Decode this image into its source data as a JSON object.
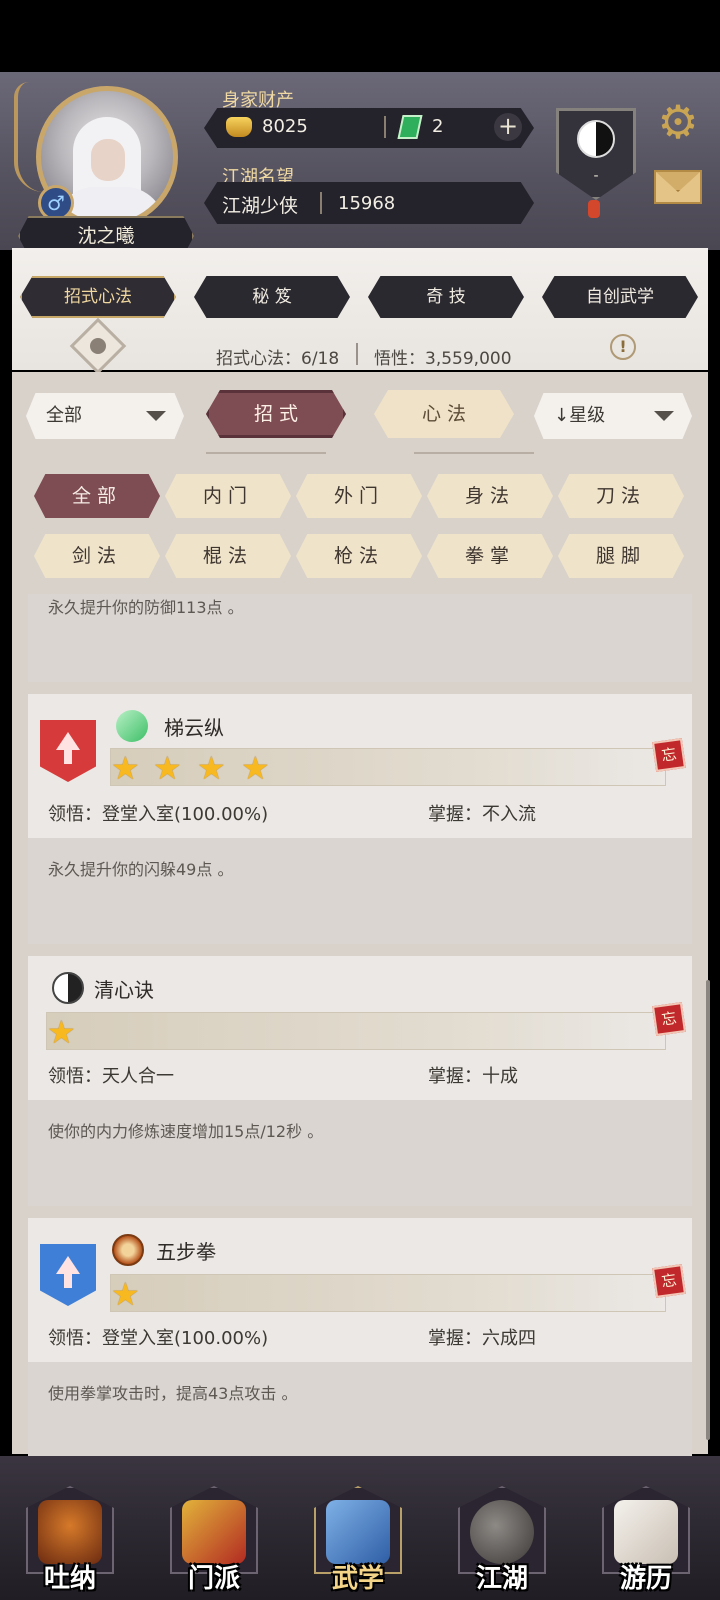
{
  "header": {
    "player_name": "沈之曦",
    "gender_symbol": "♂",
    "wealth_label": "身家财产",
    "gold": "8025",
    "jade": "2",
    "plus": "+",
    "fame_label": "江湖名望",
    "fame_title": "江湖少侠",
    "fame_value": "15968",
    "sect_value": "-"
  },
  "category_tabs": [
    {
      "label": "招式心法",
      "active": true
    },
    {
      "label": "秘 笈",
      "active": false
    },
    {
      "label": "奇 技",
      "active": false
    },
    {
      "label": "自创武学",
      "active": false
    }
  ],
  "stats": {
    "learned": "招式心法：6/18",
    "insight": "悟性：3,559,000",
    "info_mark": "!"
  },
  "filters": {
    "scope_select": "全部",
    "type_buttons": [
      {
        "label": "招 式",
        "active": true
      },
      {
        "label": "心 法",
        "active": false
      }
    ],
    "sort_select": "↓星级"
  },
  "chips": [
    {
      "label": "全部",
      "active": true
    },
    {
      "label": "内门",
      "active": false
    },
    {
      "label": "外门",
      "active": false
    },
    {
      "label": "身法",
      "active": false
    },
    {
      "label": "刀法",
      "active": false
    },
    {
      "label": "剑法",
      "active": false
    },
    {
      "label": "棍法",
      "active": false
    },
    {
      "label": "枪法",
      "active": false
    },
    {
      "label": "拳掌",
      "active": false
    },
    {
      "label": "腿脚",
      "active": false
    }
  ],
  "skills": [
    {
      "name": "",
      "stars": 0,
      "comprehension_label": "",
      "comprehension": "",
      "mastery_label": "",
      "mastery": "",
      "description": "永久提升你的防御113点 。"
    },
    {
      "name": "梯云纵",
      "stars": 4,
      "comprehension_label": "领悟",
      "comprehension": "登堂入室(100.00%)",
      "mastery_label": "掌握",
      "mastery": "不入流",
      "description": "永久提升你的闪躲49点 。",
      "rank_color": "#d73a3a"
    },
    {
      "name": "清心诀",
      "stars": 1,
      "comprehension_label": "领悟",
      "comprehension": "天人合一",
      "mastery_label": "掌握",
      "mastery": "十成",
      "description": "使你的内力修炼速度增加15点/12秒 。"
    },
    {
      "name": "五步拳",
      "stars": 1,
      "comprehension_label": "领悟",
      "comprehension": "登堂入室(100.00%)",
      "mastery_label": "掌握",
      "mastery": "六成四",
      "description": "使用拳掌攻击时，提高43点攻击 。",
      "rank_color": "#3f7fd8"
    }
  ],
  "forget_label": "忘",
  "colon": "：",
  "bottom_nav": [
    {
      "label": "吐纳",
      "icon": "monk-icon",
      "active": false
    },
    {
      "label": "门派",
      "icon": "banner-icon",
      "active": false
    },
    {
      "label": "武学",
      "icon": "book-icon",
      "active": true
    },
    {
      "label": "江湖",
      "icon": "hat-icon",
      "active": false
    },
    {
      "label": "游历",
      "icon": "horse-icon",
      "active": false
    }
  ],
  "colors": {
    "accent_active": "#7e4c53",
    "chip_bg": "#efe3ca",
    "gold": "#f7b820"
  }
}
